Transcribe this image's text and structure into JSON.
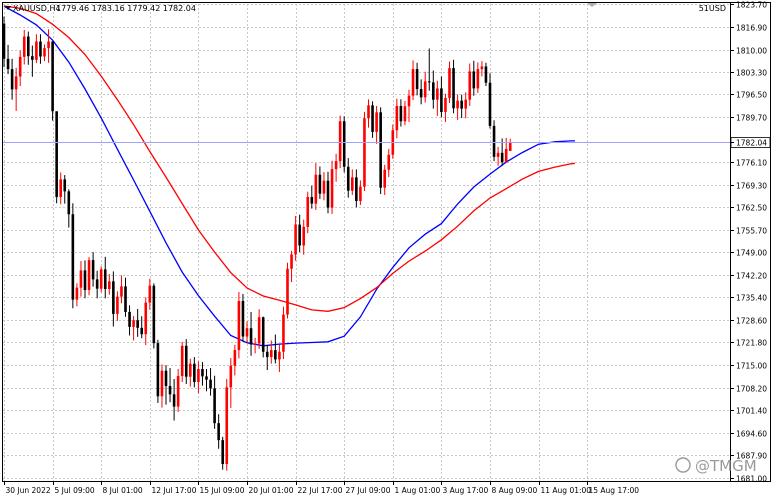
{
  "header": {
    "symbol": "XAUUSD,H4",
    "ohlc": "1779.46 1783.16 1779.42 1782.04",
    "indicator": "51USD",
    "watermark": "@TMGM"
  },
  "colors": {
    "background": "#ffffff",
    "grid": "#c8c8c8",
    "bull": "#ff0000",
    "bear": "#000000",
    "ma_fast": "#0000ff",
    "ma_slow": "#ff0000",
    "price_line": "#a0a0ff",
    "price_label_bg": "#ffffff"
  },
  "chart_data": {
    "type": "candlestick",
    "title": "",
    "xlabel": "",
    "ylabel": "",
    "ylim": [
      1681.0,
      1823.7
    ],
    "y_ticks": [
      "1823.70",
      "1816.90",
      "1810.00",
      "1803.30",
      "1796.50",
      "1789.70",
      "1782.04",
      "1776.10",
      "1769.30",
      "1762.50",
      "1755.70",
      "1749.00",
      "1742.20",
      "1735.40",
      "1728.60",
      "1721.80",
      "1715.00",
      "1708.20",
      "1701.40",
      "1694.60",
      "1687.90",
      "1681.00"
    ],
    "y_tick_values": [
      1823.7,
      1816.9,
      1810.0,
      1803.3,
      1796.5,
      1789.7,
      1782.04,
      1776.1,
      1769.3,
      1762.5,
      1755.7,
      1749.0,
      1742.2,
      1735.4,
      1728.6,
      1721.8,
      1715.0,
      1708.2,
      1701.4,
      1694.6,
      1687.9,
      1681.0
    ],
    "x_ticks": [
      "30 Jun 2022",
      "5 Jul 09:00",
      "8 Jul 01:00",
      "12 Jul 17:00",
      "15 Jul 09:00",
      "20 Jul 01:00",
      "22 Jul 17:00",
      "27 Jul 09:00",
      "1 Aug 01:00",
      "3 Aug 17:00",
      "8 Aug 09:00",
      "11 Aug 01:00",
      "15 Aug 17:00"
    ],
    "x_tick_bars": [
      0,
      12,
      24,
      36,
      48,
      60,
      72,
      84,
      96,
      108,
      120,
      132,
      144
    ],
    "current_price": 1782.04,
    "series": [
      {
        "kind": "candles",
        "fields": [
          "open",
          "high",
          "low",
          "close"
        ],
        "values": [
          [
            1817.8,
            1819.9,
            1804.7,
            1807.2
          ],
          [
            1807.2,
            1811.4,
            1802.6,
            1804.1
          ],
          [
            1804.1,
            1807.2,
            1794.9,
            1798.0
          ],
          [
            1798.0,
            1804.5,
            1791.5,
            1801.9
          ],
          [
            1801.9,
            1809.7,
            1799.0,
            1807.8
          ],
          [
            1807.8,
            1815.9,
            1805.5,
            1813.9
          ],
          [
            1813.9,
            1815.4,
            1805.4,
            1808.0
          ],
          [
            1808.0,
            1811.2,
            1801.8,
            1806.9
          ],
          [
            1806.9,
            1814.6,
            1805.9,
            1812.4
          ],
          [
            1812.4,
            1814.6,
            1805.7,
            1807.9
          ],
          [
            1807.9,
            1811.5,
            1806.5,
            1810.4
          ],
          [
            1810.4,
            1816.1,
            1806.0,
            1812.4
          ],
          [
            1812.4,
            1812.5,
            1788.6,
            1791.4
          ],
          [
            1791.4,
            1791.4,
            1763.7,
            1765.6
          ],
          [
            1765.6,
            1773.0,
            1763.4,
            1770.9
          ],
          [
            1770.9,
            1772.2,
            1763.6,
            1767.3
          ],
          [
            1767.3,
            1767.9,
            1756.4,
            1760.4
          ],
          [
            1760.4,
            1763.7,
            1732.1,
            1734.7
          ],
          [
            1734.7,
            1739.6,
            1732.7,
            1738.3
          ],
          [
            1738.3,
            1746.3,
            1735.6,
            1743.5
          ],
          [
            1743.5,
            1746.5,
            1735.1,
            1737.6
          ],
          [
            1737.6,
            1747.5,
            1736.0,
            1746.6
          ],
          [
            1746.6,
            1749.0,
            1738.6,
            1740.8
          ],
          [
            1740.8,
            1743.4,
            1735.1,
            1738.0
          ],
          [
            1738.0,
            1744.7,
            1736.9,
            1743.8
          ],
          [
            1743.8,
            1747.6,
            1735.1,
            1737.9
          ],
          [
            1737.9,
            1742.4,
            1736.2,
            1740.2
          ],
          [
            1740.2,
            1743.2,
            1726.6,
            1730.4
          ],
          [
            1730.4,
            1737.2,
            1728.3,
            1735.6
          ],
          [
            1735.6,
            1742.0,
            1733.6,
            1738.7
          ],
          [
            1738.7,
            1741.3,
            1729.5,
            1731.0
          ],
          [
            1731.0,
            1733.0,
            1723.9,
            1726.5
          ],
          [
            1726.5,
            1729.8,
            1722.4,
            1728.5
          ],
          [
            1728.5,
            1731.9,
            1723.5,
            1726.2
          ],
          [
            1726.2,
            1729.7,
            1723.1,
            1724.3
          ],
          [
            1724.3,
            1735.4,
            1721.0,
            1733.8
          ],
          [
            1733.8,
            1741.0,
            1731.7,
            1738.9
          ],
          [
            1738.9,
            1739.6,
            1720.0,
            1721.6
          ],
          [
            1721.6,
            1722.6,
            1703.6,
            1705.6
          ],
          [
            1705.6,
            1715.2,
            1702.2,
            1713.3
          ],
          [
            1713.3,
            1715.0,
            1703.1,
            1708.7
          ],
          [
            1708.7,
            1714.1,
            1703.8,
            1706.2
          ],
          [
            1706.2,
            1710.8,
            1698.3,
            1702.5
          ],
          [
            1702.5,
            1713.8,
            1700.9,
            1711.7
          ],
          [
            1711.7,
            1722.0,
            1709.9,
            1720.8
          ],
          [
            1720.8,
            1722.8,
            1709.3,
            1711.5
          ],
          [
            1711.5,
            1716.9,
            1708.5,
            1715.4
          ],
          [
            1715.4,
            1717.4,
            1708.3,
            1709.9
          ],
          [
            1709.9,
            1716.1,
            1706.5,
            1713.8
          ],
          [
            1713.8,
            1715.9,
            1708.8,
            1711.6
          ],
          [
            1711.6,
            1713.8,
            1707.1,
            1710.6
          ],
          [
            1710.6,
            1714.1,
            1705.8,
            1708.0
          ],
          [
            1708.0,
            1711.8,
            1695.8,
            1697.5
          ],
          [
            1697.5,
            1700.2,
            1689.8,
            1692.4
          ],
          [
            1692.4,
            1693.4,
            1683.5,
            1685.2
          ],
          [
            1685.2,
            1710.8,
            1683.2,
            1708.3
          ],
          [
            1708.3,
            1717.1,
            1702.1,
            1714.8
          ],
          [
            1714.8,
            1721.1,
            1711.9,
            1719.5
          ],
          [
            1719.5,
            1737.0,
            1717.0,
            1734.3
          ],
          [
            1734.3,
            1736.4,
            1722.0,
            1723.6
          ],
          [
            1723.6,
            1728.2,
            1721.8,
            1726.1
          ],
          [
            1726.1,
            1731.0,
            1717.8,
            1721.2
          ],
          [
            1721.2,
            1723.2,
            1718.5,
            1721.5
          ],
          [
            1721.5,
            1731.8,
            1719.9,
            1729.4
          ],
          [
            1729.4,
            1729.6,
            1717.3,
            1719.0
          ],
          [
            1719.0,
            1721.0,
            1713.5,
            1717.4
          ],
          [
            1717.4,
            1722.4,
            1715.4,
            1719.5
          ],
          [
            1719.5,
            1724.2,
            1715.5,
            1716.7
          ],
          [
            1716.7,
            1721.2,
            1712.9,
            1719.0
          ],
          [
            1719.0,
            1732.6,
            1716.8,
            1730.2
          ],
          [
            1730.2,
            1745.8,
            1729.0,
            1744.0
          ],
          [
            1744.0,
            1749.4,
            1740.0,
            1748.3
          ],
          [
            1748.3,
            1759.9,
            1746.4,
            1757.3
          ],
          [
            1757.3,
            1760.3,
            1749.0,
            1751.0
          ],
          [
            1751.0,
            1758.8,
            1748.2,
            1756.6
          ],
          [
            1756.6,
            1767.2,
            1754.7,
            1765.6
          ],
          [
            1765.6,
            1769.0,
            1762.1,
            1763.6
          ],
          [
            1763.6,
            1775.8,
            1761.7,
            1772.3
          ],
          [
            1772.3,
            1774.8,
            1765.0,
            1766.6
          ],
          [
            1766.6,
            1773.1,
            1764.6,
            1770.5
          ],
          [
            1770.5,
            1773.2,
            1760.7,
            1762.4
          ],
          [
            1762.4,
            1776.5,
            1760.5,
            1774.0
          ],
          [
            1774.0,
            1778.6,
            1770.2,
            1776.4
          ],
          [
            1776.4,
            1790.1,
            1774.3,
            1788.4
          ],
          [
            1788.4,
            1789.9,
            1773.0,
            1774.7
          ],
          [
            1774.7,
            1777.3,
            1765.4,
            1767.5
          ],
          [
            1767.5,
            1773.9,
            1766.2,
            1771.5
          ],
          [
            1771.5,
            1773.9,
            1762.5,
            1764.4
          ],
          [
            1764.4,
            1770.6,
            1763.2,
            1768.7
          ],
          [
            1768.7,
            1791.2,
            1767.4,
            1789.3
          ],
          [
            1789.3,
            1795.0,
            1786.5,
            1793.2
          ],
          [
            1793.2,
            1794.4,
            1783.4,
            1785.2
          ],
          [
            1785.2,
            1793.0,
            1781.6,
            1791.1
          ],
          [
            1791.1,
            1792.6,
            1766.5,
            1768.4
          ],
          [
            1768.4,
            1775.3,
            1766.2,
            1773.8
          ],
          [
            1773.8,
            1780.1,
            1771.6,
            1778.3
          ],
          [
            1778.3,
            1787.4,
            1777.1,
            1785.7
          ],
          [
            1785.7,
            1795.2,
            1783.3,
            1793.0
          ],
          [
            1793.0,
            1795.0,
            1786.8,
            1788.4
          ],
          [
            1788.4,
            1794.5,
            1787.2,
            1792.9
          ],
          [
            1792.9,
            1797.9,
            1788.2,
            1796.1
          ],
          [
            1796.1,
            1806.7,
            1794.8,
            1804.1
          ],
          [
            1804.1,
            1806.0,
            1796.2,
            1798.1
          ],
          [
            1798.1,
            1801.0,
            1793.5,
            1795.6
          ],
          [
            1795.6,
            1803.3,
            1794.0,
            1800.4
          ],
          [
            1800.4,
            1810.3,
            1797.6,
            1800.1
          ],
          [
            1800.1,
            1803.7,
            1792.2,
            1794.9
          ],
          [
            1794.9,
            1800.6,
            1790.0,
            1798.3
          ],
          [
            1798.3,
            1801.9,
            1789.6,
            1791.2
          ],
          [
            1791.2,
            1796.7,
            1788.2,
            1795.4
          ],
          [
            1795.4,
            1806.4,
            1793.9,
            1804.4
          ],
          [
            1804.4,
            1806.9,
            1790.8,
            1792.3
          ],
          [
            1792.3,
            1796.5,
            1788.8,
            1794.6
          ],
          [
            1794.6,
            1796.4,
            1789.4,
            1792.2
          ],
          [
            1792.2,
            1797.1,
            1789.3,
            1794.9
          ],
          [
            1794.9,
            1805.8,
            1793.0,
            1803.4
          ],
          [
            1803.4,
            1806.6,
            1796.1,
            1798.3
          ],
          [
            1798.3,
            1806.1,
            1796.9,
            1804.1
          ],
          [
            1804.1,
            1806.5,
            1801.9,
            1804.9
          ],
          [
            1804.9,
            1806.0,
            1799.0,
            1800.0
          ],
          [
            1800.0,
            1802.8,
            1786.2,
            1787.0
          ],
          [
            1787.0,
            1788.7,
            1776.4,
            1777.7
          ],
          [
            1777.7,
            1780.7,
            1775.0,
            1778.9
          ],
          [
            1778.9,
            1783.2,
            1774.9,
            1776.1
          ],
          [
            1776.1,
            1783.4,
            1776.0,
            1780.1
          ],
          [
            1779.46,
            1783.16,
            1779.42,
            1782.04
          ]
        ]
      },
      {
        "kind": "line",
        "color_key": "ma_fast",
        "points": [
          [
            0,
            1823.0
          ],
          [
            4,
            1820.4
          ],
          [
            8,
            1817.4
          ],
          [
            12,
            1812.8
          ],
          [
            16,
            1806.2
          ],
          [
            20,
            1798.1
          ],
          [
            24,
            1789.4
          ],
          [
            28,
            1780.0
          ],
          [
            32,
            1770.7
          ],
          [
            36,
            1761.3
          ],
          [
            40,
            1751.8
          ],
          [
            44,
            1743.0
          ],
          [
            48,
            1735.9
          ],
          [
            52,
            1729.7
          ],
          [
            56,
            1723.9
          ],
          [
            60,
            1721.7
          ],
          [
            64,
            1720.8
          ],
          [
            68,
            1721.3
          ],
          [
            72,
            1721.6
          ],
          [
            76,
            1721.8
          ],
          [
            80,
            1722.0
          ],
          [
            84,
            1723.7
          ],
          [
            88,
            1729.5
          ],
          [
            92,
            1737.8
          ],
          [
            96,
            1744.4
          ],
          [
            100,
            1750.3
          ],
          [
            104,
            1754.4
          ],
          [
            108,
            1757.6
          ],
          [
            112,
            1763.5
          ],
          [
            116,
            1768.6
          ],
          [
            120,
            1772.5
          ],
          [
            124,
            1776.1
          ],
          [
            128,
            1779.0
          ],
          [
            132,
            1781.5
          ],
          [
            136,
            1782.2
          ],
          [
            140,
            1782.5
          ],
          [
            141,
            1782.5
          ]
        ]
      },
      {
        "kind": "line",
        "color_key": "ma_slow",
        "points": [
          [
            0,
            1823.1
          ],
          [
            4,
            1822.4
          ],
          [
            8,
            1820.8
          ],
          [
            12,
            1817.6
          ],
          [
            16,
            1813.6
          ],
          [
            20,
            1808.5
          ],
          [
            24,
            1802.0
          ],
          [
            28,
            1794.9
          ],
          [
            32,
            1787.4
          ],
          [
            36,
            1779.3
          ],
          [
            40,
            1771.6
          ],
          [
            44,
            1763.6
          ],
          [
            48,
            1755.7
          ],
          [
            52,
            1749.0
          ],
          [
            56,
            1742.8
          ],
          [
            60,
            1738.2
          ],
          [
            64,
            1735.8
          ],
          [
            68,
            1734.5
          ],
          [
            72,
            1733.1
          ],
          [
            76,
            1731.6
          ],
          [
            80,
            1731.2
          ],
          [
            84,
            1732.3
          ],
          [
            88,
            1735.0
          ],
          [
            92,
            1738.3
          ],
          [
            96,
            1742.6
          ],
          [
            100,
            1746.3
          ],
          [
            104,
            1749.3
          ],
          [
            108,
            1752.7
          ],
          [
            112,
            1756.8
          ],
          [
            116,
            1761.4
          ],
          [
            120,
            1765.3
          ],
          [
            124,
            1768.1
          ],
          [
            128,
            1771.0
          ],
          [
            132,
            1773.3
          ],
          [
            136,
            1774.6
          ],
          [
            140,
            1775.6
          ],
          [
            141,
            1775.7
          ]
        ]
      }
    ]
  }
}
